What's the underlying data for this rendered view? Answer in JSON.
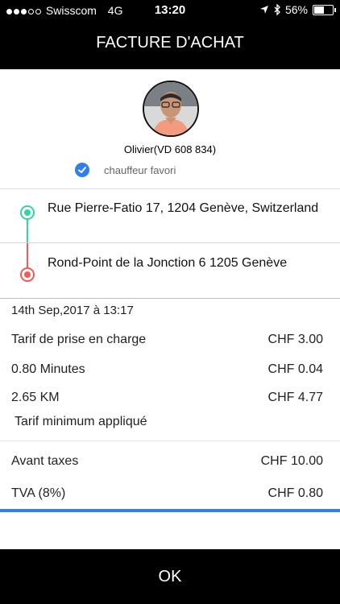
{
  "status": {
    "carrier": "Swisscom",
    "network": "4G",
    "time": "13:20",
    "battery": "56%",
    "battery_level": 0.56
  },
  "nav": {
    "title": "FACTURE D'ACHAT"
  },
  "driver": {
    "name": "Olivier(VD 608 834)",
    "favorite_label": "chauffeur favori"
  },
  "route": {
    "pickup": "Rue Pierre-Fatio 17, 1204 Genève, Switzerland",
    "dropoff": "Rond-Point de la Jonction 6 1205 Genève"
  },
  "trip": {
    "datetime": "14th Sep,2017 à 13:17",
    "items": [
      {
        "label": "Tarif de prise en charge",
        "value": "CHF 3.00"
      },
      {
        "label": "0.80 Minutes",
        "value": "CHF 0.04"
      },
      {
        "label": "2.65 KM",
        "value": "CHF 4.77"
      }
    ],
    "minimum_note": "Tarif minimum appliqué"
  },
  "totals": {
    "before_tax_label": "Avant taxes",
    "before_tax_value": "CHF 10.00",
    "vat_label": "TVA (8%)",
    "vat_value": "CHF 0.80"
  },
  "ok_label": "OK",
  "colors": {
    "accent": "#2f80ed",
    "pickup": "#32d4a5",
    "dropoff": "#f05a5a"
  }
}
